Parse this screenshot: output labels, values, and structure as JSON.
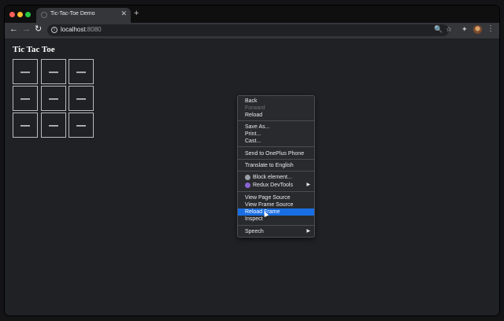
{
  "browser": {
    "tab": {
      "title": "Tic-Tac-Toe Demo",
      "close": "✕"
    },
    "new_tab": "+",
    "nav": {
      "back": "←",
      "forward": "→",
      "reload": "↻"
    },
    "address": {
      "host": "localhost",
      "port": ":8080"
    },
    "icons": {
      "zoom": "🔍",
      "star": "☆",
      "extensions": "✦",
      "menu": "⋮"
    }
  },
  "page": {
    "title": "Tic Tac Toe",
    "board": [
      "—",
      "—",
      "—",
      "—",
      "—",
      "—",
      "—",
      "—",
      "—"
    ]
  },
  "context_menu": {
    "groups": [
      [
        {
          "label": "Back",
          "state": "normal"
        },
        {
          "label": "Forward",
          "state": "disabled"
        },
        {
          "label": "Reload",
          "state": "normal"
        }
      ],
      [
        {
          "label": "Save As...",
          "state": "normal"
        },
        {
          "label": "Print...",
          "state": "normal"
        },
        {
          "label": "Cast...",
          "state": "normal"
        }
      ],
      [
        {
          "label": "Send to OnePlus Phone",
          "state": "normal"
        }
      ],
      [
        {
          "label": "Translate to English",
          "state": "normal"
        }
      ],
      [
        {
          "label": "Block element...",
          "state": "normal",
          "icon": "block-element-icon",
          "icon_color": "#9aa0a6"
        },
        {
          "label": "Redux DevTools",
          "state": "normal",
          "icon": "redux-devtools-icon",
          "icon_color": "#8a63d2",
          "submenu": true
        }
      ],
      [
        {
          "label": "View Page Source",
          "state": "normal"
        },
        {
          "label": "View Frame Source",
          "state": "normal"
        },
        {
          "label": "Reload Frame",
          "state": "highlighted"
        },
        {
          "label": "Inspect",
          "state": "normal"
        }
      ],
      [
        {
          "label": "Speech",
          "state": "normal",
          "submenu": true
        }
      ]
    ],
    "submenu_arrow": "▶"
  },
  "colors": {
    "highlight": "#1a6ee3",
    "background": "#202124",
    "menu": "#292a2d"
  }
}
